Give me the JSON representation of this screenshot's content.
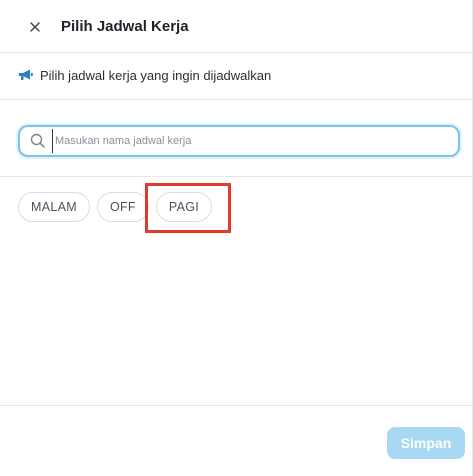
{
  "dialog": {
    "title": "Pilih Jadwal Kerja",
    "close_icon": "close-icon"
  },
  "info": {
    "icon": "megaphone-icon",
    "text": "Pilih jadwal kerja yang ingin dijadwalkan"
  },
  "search": {
    "icon": "search-icon",
    "placeholder": "Masukan nama jadwal kerja",
    "value": ""
  },
  "schedules": [
    {
      "label": "MALAM"
    },
    {
      "label": "OFF"
    },
    {
      "label": "PAGI"
    }
  ],
  "highlight": {
    "target": "PAGI",
    "color": "#e03a2f"
  },
  "footer": {
    "save_label": "Simpan"
  },
  "colors": {
    "accent": "#7cc3ea",
    "save_button_disabled": "#a8d8f3",
    "highlight": "#e03a2f"
  }
}
